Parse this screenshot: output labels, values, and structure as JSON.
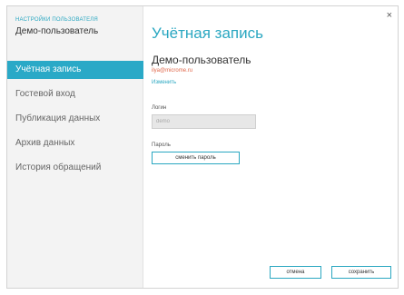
{
  "window": {
    "close_glyph": "×"
  },
  "sidebar": {
    "caption": "НАСТРОЙКИ ПОЛЬЗОВАТЕЛЯ",
    "user": "Демо-пользователь",
    "items": [
      {
        "label": "Учётная запись",
        "active": true
      },
      {
        "label": "Гостевой вход",
        "active": false
      },
      {
        "label": "Публикация данных",
        "active": false
      },
      {
        "label": "Архив данных",
        "active": false
      },
      {
        "label": "История обращений",
        "active": false
      }
    ]
  },
  "main": {
    "title": "Учётная запись",
    "user_name": "Демо-пользователь",
    "email": "ilya@microme.ru",
    "change_link": "Изменить",
    "login_label": "Логин",
    "login_value": "demo",
    "password_label": "Пароль",
    "change_password_button": "сменить пароль"
  },
  "footer": {
    "cancel_button": "отмена",
    "save_button": "сохранить"
  },
  "colors": {
    "accent": "#2aa9c7",
    "email": "#e0684b"
  }
}
